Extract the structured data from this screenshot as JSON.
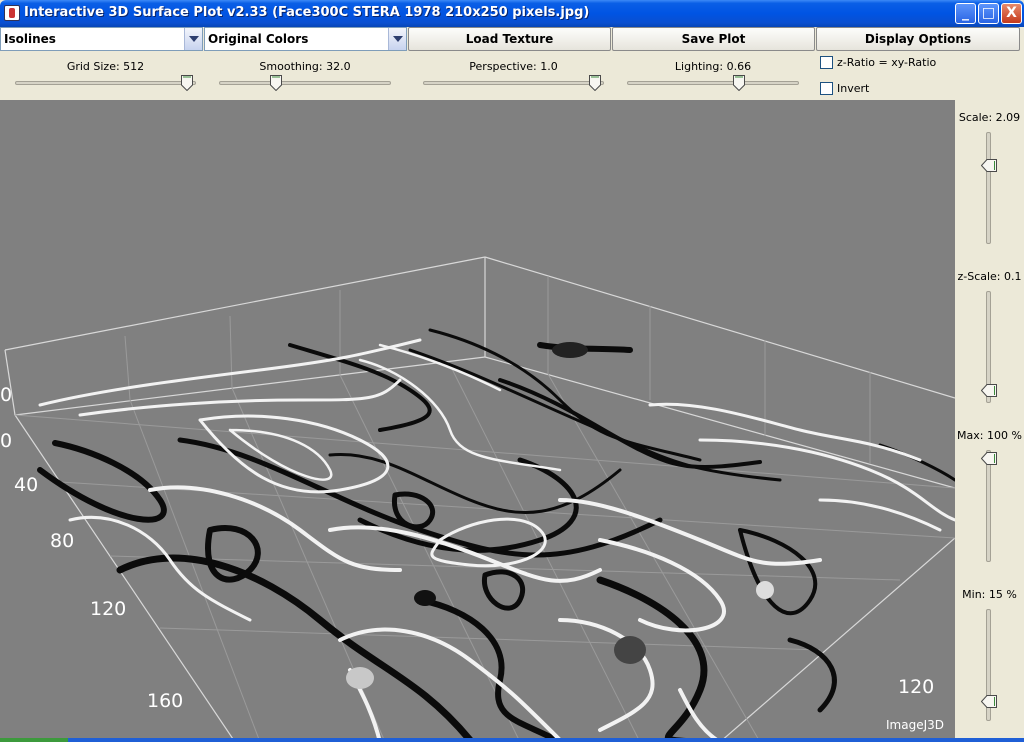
{
  "window": {
    "title": "Interactive 3D Surface Plot v2.33  (Face300C STERA 1978 210x250 pixels.jpg)",
    "controls": {
      "minimize": "_",
      "maximize": "□",
      "close": "X"
    }
  },
  "toolbar": {
    "mode_select": "Isolines",
    "color_select": "Original Colors",
    "load_texture": "Load Texture",
    "save_plot": "Save Plot",
    "display_options": "Display Options"
  },
  "sliders": {
    "grid_size": {
      "label": "Grid Size: 512",
      "fraction": 0.98
    },
    "smoothing": {
      "label": "Smoothing: 32.0",
      "fraction": 0.32
    },
    "perspective": {
      "label": "Perspective: 1.0",
      "fraction": 0.98
    },
    "lighting": {
      "label": "Lighting: 0.66",
      "fraction": 0.66
    }
  },
  "checkboxes": {
    "z_ratio": {
      "label": "z-Ratio = xy-Ratio",
      "checked": false
    },
    "invert": {
      "label": "Invert",
      "checked": false
    }
  },
  "vertical_sliders": {
    "scale": {
      "label": "Scale: 2.09",
      "fraction": 0.75
    },
    "z_scale": {
      "label": "z-Scale: 0.1",
      "fraction": 0.08
    },
    "max": {
      "label": "Max: 100 %",
      "fraction": 1.0
    },
    "min": {
      "label": "Min: 15 %",
      "fraction": 0.15
    }
  },
  "plot": {
    "axis_labels_left": [
      "0",
      "0",
      "40",
      "80",
      "120",
      "160"
    ],
    "axis_label_right": "120",
    "watermark": "ImageJ3D",
    "colors": {
      "background": "#808080",
      "box": "#d8d8d8",
      "isoline_dark": "#0b0b0b",
      "isoline_light": "#f2f2f2"
    }
  }
}
